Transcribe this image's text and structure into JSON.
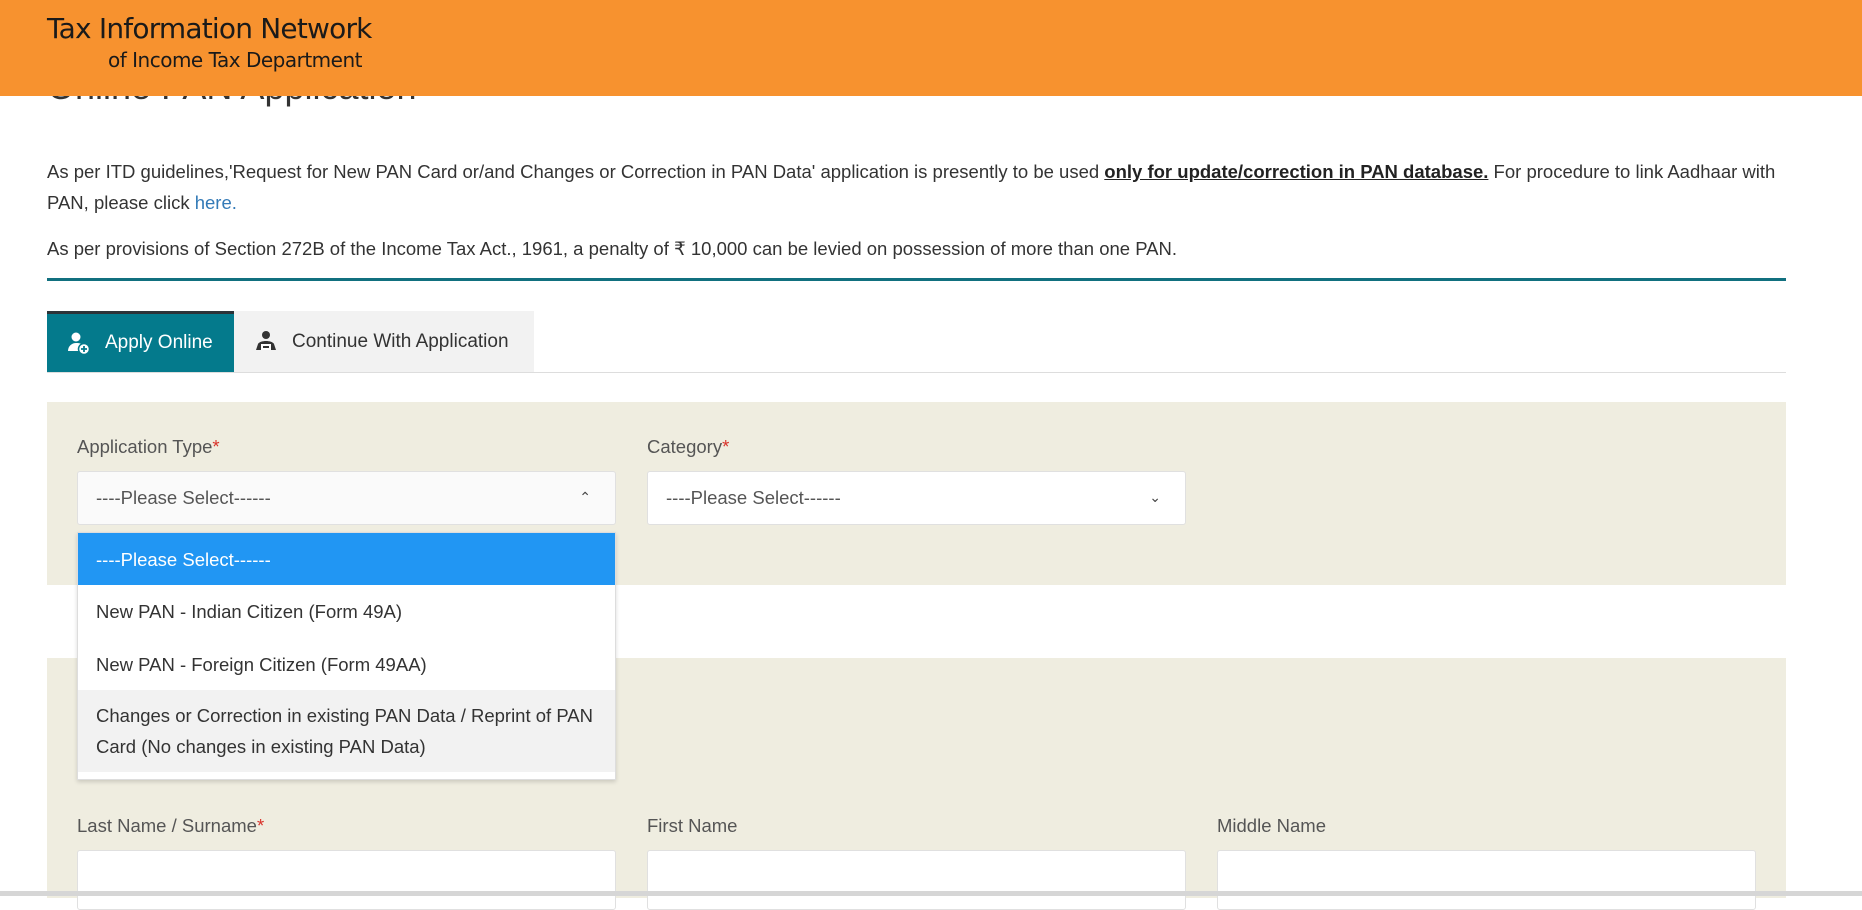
{
  "header": {
    "title": "Tax Information Network",
    "subtitle": "of Income Tax Department",
    "bg_color": "#f7922f"
  },
  "page_title": "Online PAN Application",
  "notice": {
    "p1_start": "As per ITD guidelines,'Request for New PAN Card or/and Changes or Correction in PAN Data' application is presently to be used ",
    "p1_bold": "only for update/correction in PAN database.",
    "p1_end": " For procedure to link Aadhaar with PAN, please click ",
    "p1_link": "here.",
    "p2": "As per provisions of Section 272B of the Income Tax Act., 1961, a penalty of ₹ 10,000 can be levied on possession of more than one PAN."
  },
  "tabs": [
    {
      "label": "Apply Online",
      "icon": "user-plus-icon",
      "active": true
    },
    {
      "label": "Continue With Application",
      "icon": "user-reading-icon",
      "active": false
    }
  ],
  "form": {
    "application_type": {
      "label": "Application Type",
      "value": "----Please Select------",
      "open": true,
      "options": [
        "----Please Select------",
        "New PAN - Indian Citizen (Form 49A)",
        "New PAN - Foreign Citizen (Form 49AA)",
        "Changes or Correction in existing PAN Data / Reprint of PAN Card (No changes in existing PAN Data)"
      ]
    },
    "category": {
      "label": "Category",
      "value": "----Please Select------"
    },
    "last_name": {
      "label": "Last Name / Surname",
      "value": ""
    },
    "first_name": {
      "label": "First Name",
      "value": ""
    },
    "middle_name": {
      "label": "Middle Name",
      "value": ""
    },
    "required_mark": "*"
  },
  "colors": {
    "accent": "#047a8c",
    "highlight": "#2196f3",
    "panel": "#efede0"
  }
}
